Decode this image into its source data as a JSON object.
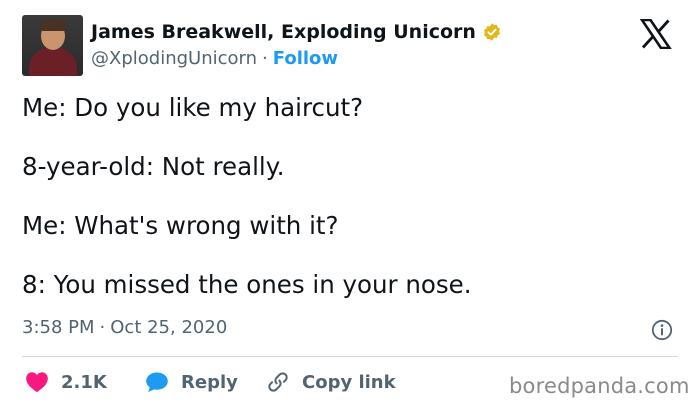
{
  "author": {
    "display_name": "James Breakwell, Exploding Unicorn",
    "handle": "@XplodingUnicorn",
    "separator": "·",
    "follow_label": "Follow",
    "verified_color": "#e2b719"
  },
  "brand": {
    "logo": "x-logo-icon"
  },
  "tweet": {
    "lines": [
      "Me: Do you like my haircut?",
      "8-year-old: Not really.",
      "Me: What's wrong with it?",
      "8: You missed the ones in your nose."
    ],
    "time": "3:58 PM",
    "separator": "·",
    "date": "Oct 25, 2020"
  },
  "actions": {
    "likes_count": "2.1K",
    "reply_label": "Reply",
    "copy_link_label": "Copy link"
  },
  "colors": {
    "like": "#f91880",
    "reply": "#1d9bf0",
    "follow": "#1d9bf0",
    "secondary_text": "#536471"
  },
  "watermark": "boredpanda.com"
}
